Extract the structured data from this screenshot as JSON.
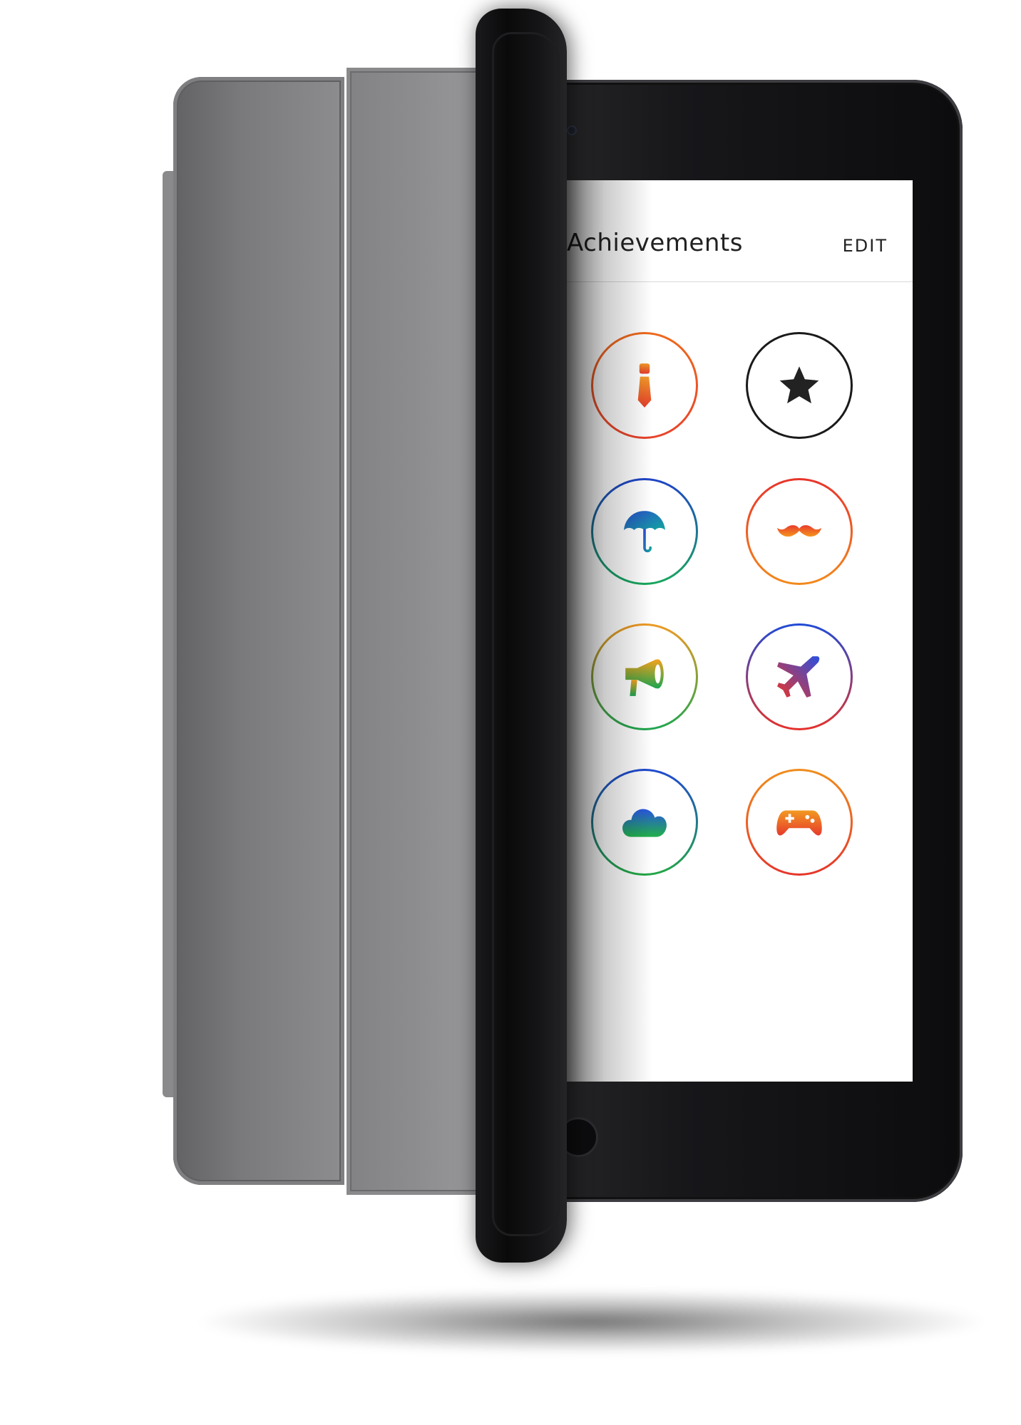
{
  "header": {
    "title": "Achievements",
    "edit_label": "EDIT"
  },
  "badges": [
    {
      "icon": "tie-icon",
      "ring_colors": [
        "#ee6a1c",
        "#e8432b"
      ],
      "icon_colors": [
        "#f29a2a",
        "#e53d2b"
      ]
    },
    {
      "icon": "star-icon",
      "ring_colors": [
        "#1a1a1a",
        "#1a1a1a"
      ],
      "icon_colors": [
        "#222222",
        "#222222"
      ]
    },
    {
      "icon": "umbrella-icon",
      "ring_colors": [
        "#1f44c8",
        "#18a85c"
      ],
      "icon_colors": [
        "#2a4fd0",
        "#12a59c"
      ]
    },
    {
      "icon": "mustache-icon",
      "ring_colors": [
        "#e8332b",
        "#f28a1c"
      ],
      "icon_colors": [
        "#e83b2b",
        "#f5961e"
      ]
    },
    {
      "icon": "megaphone-icon",
      "ring_colors": [
        "#f09a22",
        "#1fa64f"
      ],
      "icon_colors": [
        "#f6a21c",
        "#1aa551"
      ]
    },
    {
      "icon": "airplane-icon",
      "ring_colors": [
        "#1f4bd6",
        "#e6312b"
      ],
      "icon_colors": [
        "#2a4fe0",
        "#e8342b"
      ]
    },
    {
      "icon": "cloud-icon",
      "ring_colors": [
        "#1f49d0",
        "#23a844"
      ],
      "icon_colors": [
        "#2955e0",
        "#22b04a"
      ]
    },
    {
      "icon": "gamepad-icon",
      "ring_colors": [
        "#f08e1c",
        "#e6352b"
      ],
      "icon_colors": [
        "#f29a22",
        "#e63a2b"
      ]
    }
  ]
}
